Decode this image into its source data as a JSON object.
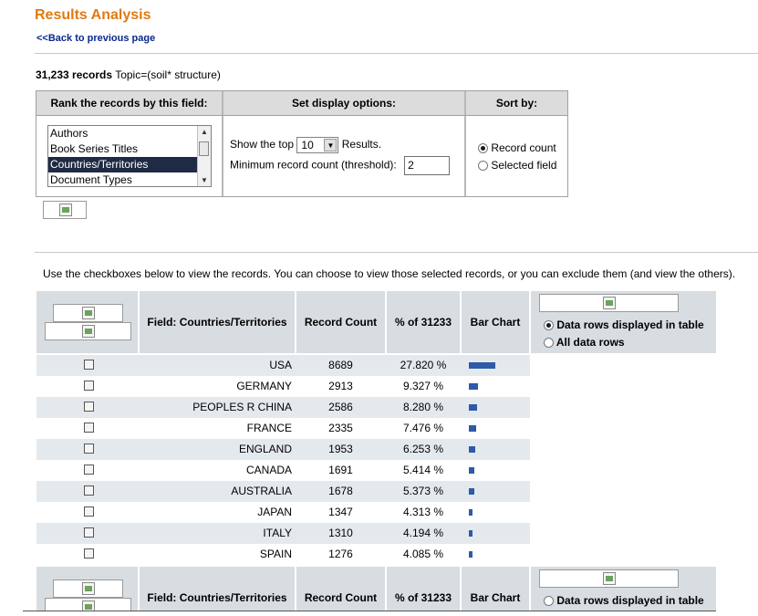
{
  "header": {
    "title": "Results Analysis",
    "back_link": "<<Back to previous page"
  },
  "summary": {
    "count": "31,233 records",
    "topic": "Topic=(soil* structure)"
  },
  "options": {
    "rank_header": "Rank the records by this field:",
    "display_header": "Set display options:",
    "sort_header": "Sort by:",
    "fields": [
      "Authors",
      "Book Series Titles",
      "Countries/Territories",
      "Document Types"
    ],
    "selected_field_index": 2,
    "show_top_label": "Show the top",
    "show_top_value": "10",
    "results_label": "Results.",
    "min_count_label": "Minimum record count (threshold):",
    "min_count_value": "2",
    "sort_record_count": "Record count",
    "sort_selected_field": "Selected field",
    "sort_selected": "Record count"
  },
  "instructions": "Use the checkboxes below to view the records. You can choose to view those selected records, or you can exclude them (and view the others).",
  "table": {
    "col_field": "Field: Countries/Territories",
    "col_count": "Record Count",
    "col_percent": "% of 31233",
    "col_bar": "Bar Chart",
    "option_displayed": "Data rows displayed in table",
    "option_all": "All data rows",
    "rows": [
      {
        "country": "USA",
        "count": 8689,
        "count_text": "8689",
        "percent": "27.820 %"
      },
      {
        "country": "GERMANY",
        "count": 2913,
        "count_text": "2913",
        "percent": "9.327 %"
      },
      {
        "country": "PEOPLES R CHINA",
        "count": 2586,
        "count_text": "2586",
        "percent": "8.280 %"
      },
      {
        "country": "FRANCE",
        "count": 2335,
        "count_text": "2335",
        "percent": "7.476 %"
      },
      {
        "country": "ENGLAND",
        "count": 1953,
        "count_text": "1953",
        "percent": "6.253 %"
      },
      {
        "country": "CANADA",
        "count": 1691,
        "count_text": "1691",
        "percent": "5.414 %"
      },
      {
        "country": "AUSTRALIA",
        "count": 1678,
        "count_text": "1678",
        "percent": "5.373 %"
      },
      {
        "country": "JAPAN",
        "count": 1347,
        "count_text": "1347",
        "percent": "4.313 %"
      },
      {
        "country": "ITALY",
        "count": 1310,
        "count_text": "1310",
        "percent": "4.194 %"
      },
      {
        "country": "SPAIN",
        "count": 1276,
        "count_text": "1276",
        "percent": "4.085 %"
      }
    ]
  },
  "colors": {
    "title": "#e07a10",
    "link": "#0a2a8a",
    "bar": "#2f5aa8",
    "header_bg": "#d8dde1",
    "alt_row": "#e4e9ee"
  }
}
